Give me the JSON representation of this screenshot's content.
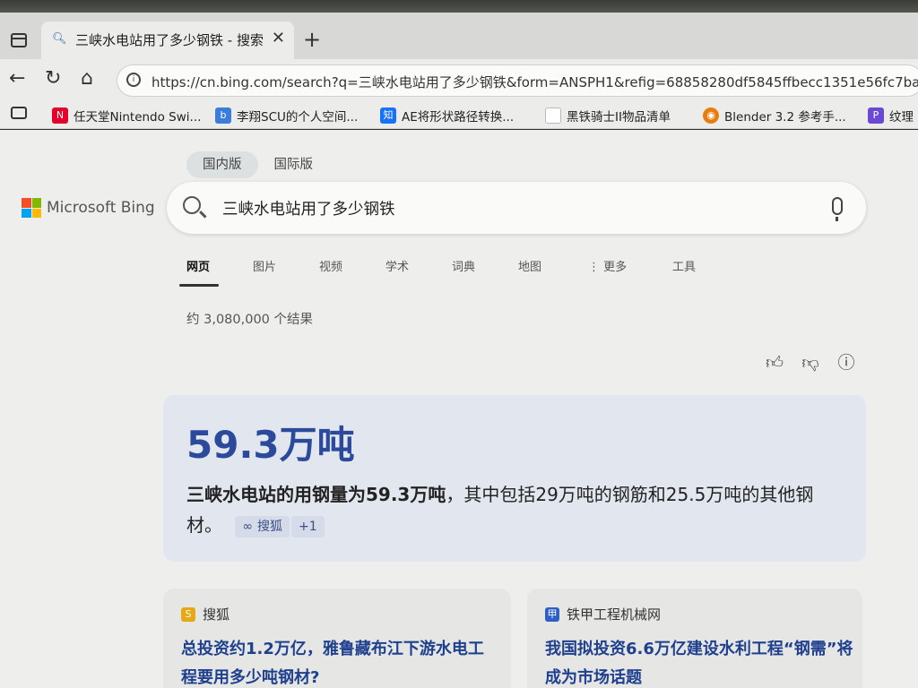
{
  "browser": {
    "tab": {
      "title": "三峡水电站用了多少钢铁 - 搜索"
    },
    "address": {
      "url": "https://cn.bing.com/search?q=三峡水电站用了多少钢铁&form=ANSPH1&refig=68858280df5845ffbecc1351e56fc7ba"
    },
    "bookmarks": [
      {
        "label": "任天堂Nintendo Swi...",
        "icon": "nintendo-icon",
        "color": "#e4002b"
      },
      {
        "label": "李翔SCU的个人空间...",
        "icon": "bilibili-icon",
        "color": "#3b7dd8"
      },
      {
        "label": "AE将形状路径转换...",
        "icon": "zhihu-icon",
        "color": "#1772f6"
      },
      {
        "label": "黑铁骑士II物品清单",
        "icon": "page-icon",
        "color": "#ffffff"
      },
      {
        "label": "Blender 3.2 参考手...",
        "icon": "blender-icon",
        "color": "#e87d0d"
      },
      {
        "label": "纹理",
        "icon": "texture-icon",
        "color": "#6a4ad4"
      }
    ]
  },
  "bing": {
    "regions": [
      "国内版",
      "国际版"
    ],
    "logo_text": "Microsoft Bing",
    "query": "三峡水电站用了多少钢铁",
    "scopes": [
      "网页",
      "图片",
      "视频",
      "学术",
      "词典",
      "地图",
      "更多",
      "工具"
    ],
    "results_count": "约 3,080,000 个结果",
    "answer": {
      "headline": "59.3万吨",
      "bold": "三峡水电站的用钢量为59.3万吨",
      "rest": "，其中包括29万吨的钢筋和25.5万吨的其他钢材。",
      "cite_source": "搜狐",
      "cite_more": "+1"
    },
    "cards": [
      {
        "source": "搜狐",
        "title": "总投资约1.2万亿，雅鲁藏布江下游水电工程要用多少吨钢材?",
        "icon_color": "#e6a817"
      },
      {
        "source": "铁甲工程机械网",
        "title": "我国拟投资6.6万亿建设水利工程“钢需”将成为市场话题",
        "icon_color": "#2d5fc4"
      }
    ]
  }
}
